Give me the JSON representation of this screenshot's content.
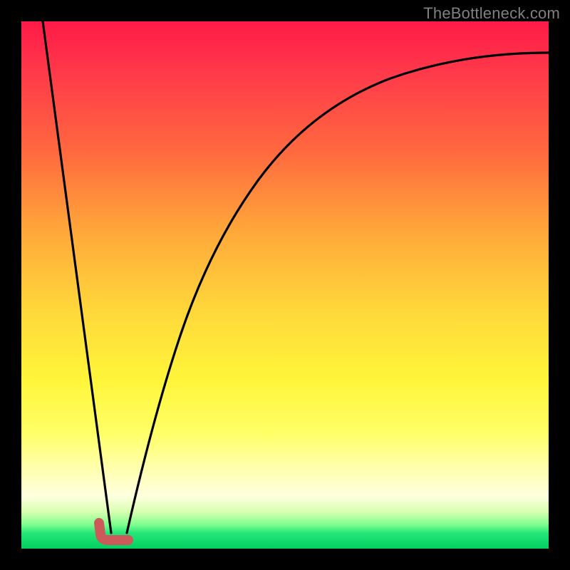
{
  "watermark": "TheBottleneck.com",
  "chart_data": {
    "type": "line",
    "title": "",
    "xlabel": "",
    "ylabel": "",
    "xlim": [
      0,
      100
    ],
    "ylim": [
      0,
      100
    ],
    "grid": false,
    "legend": false,
    "background_gradient": {
      "top": "#ff1a47",
      "mid": "#fff53a",
      "bottom": "#00d060"
    },
    "series": [
      {
        "name": "left-descent",
        "stroke": "#000000",
        "x": [
          4,
          17
        ],
        "values": [
          100,
          3
        ]
      },
      {
        "name": "right-curve",
        "stroke": "#000000",
        "x": [
          20,
          25,
          30,
          35,
          40,
          45,
          50,
          55,
          60,
          70,
          80,
          90,
          100
        ],
        "values": [
          3,
          22,
          40,
          55,
          65,
          72,
          78,
          82,
          85,
          89,
          91.5,
          93,
          94
        ]
      }
    ],
    "annotation": {
      "name": "minimum-marker",
      "shape": "L",
      "color": "#cc5a5a",
      "x_range": [
        14.5,
        20.5
      ],
      "y_level": 2.5
    }
  }
}
